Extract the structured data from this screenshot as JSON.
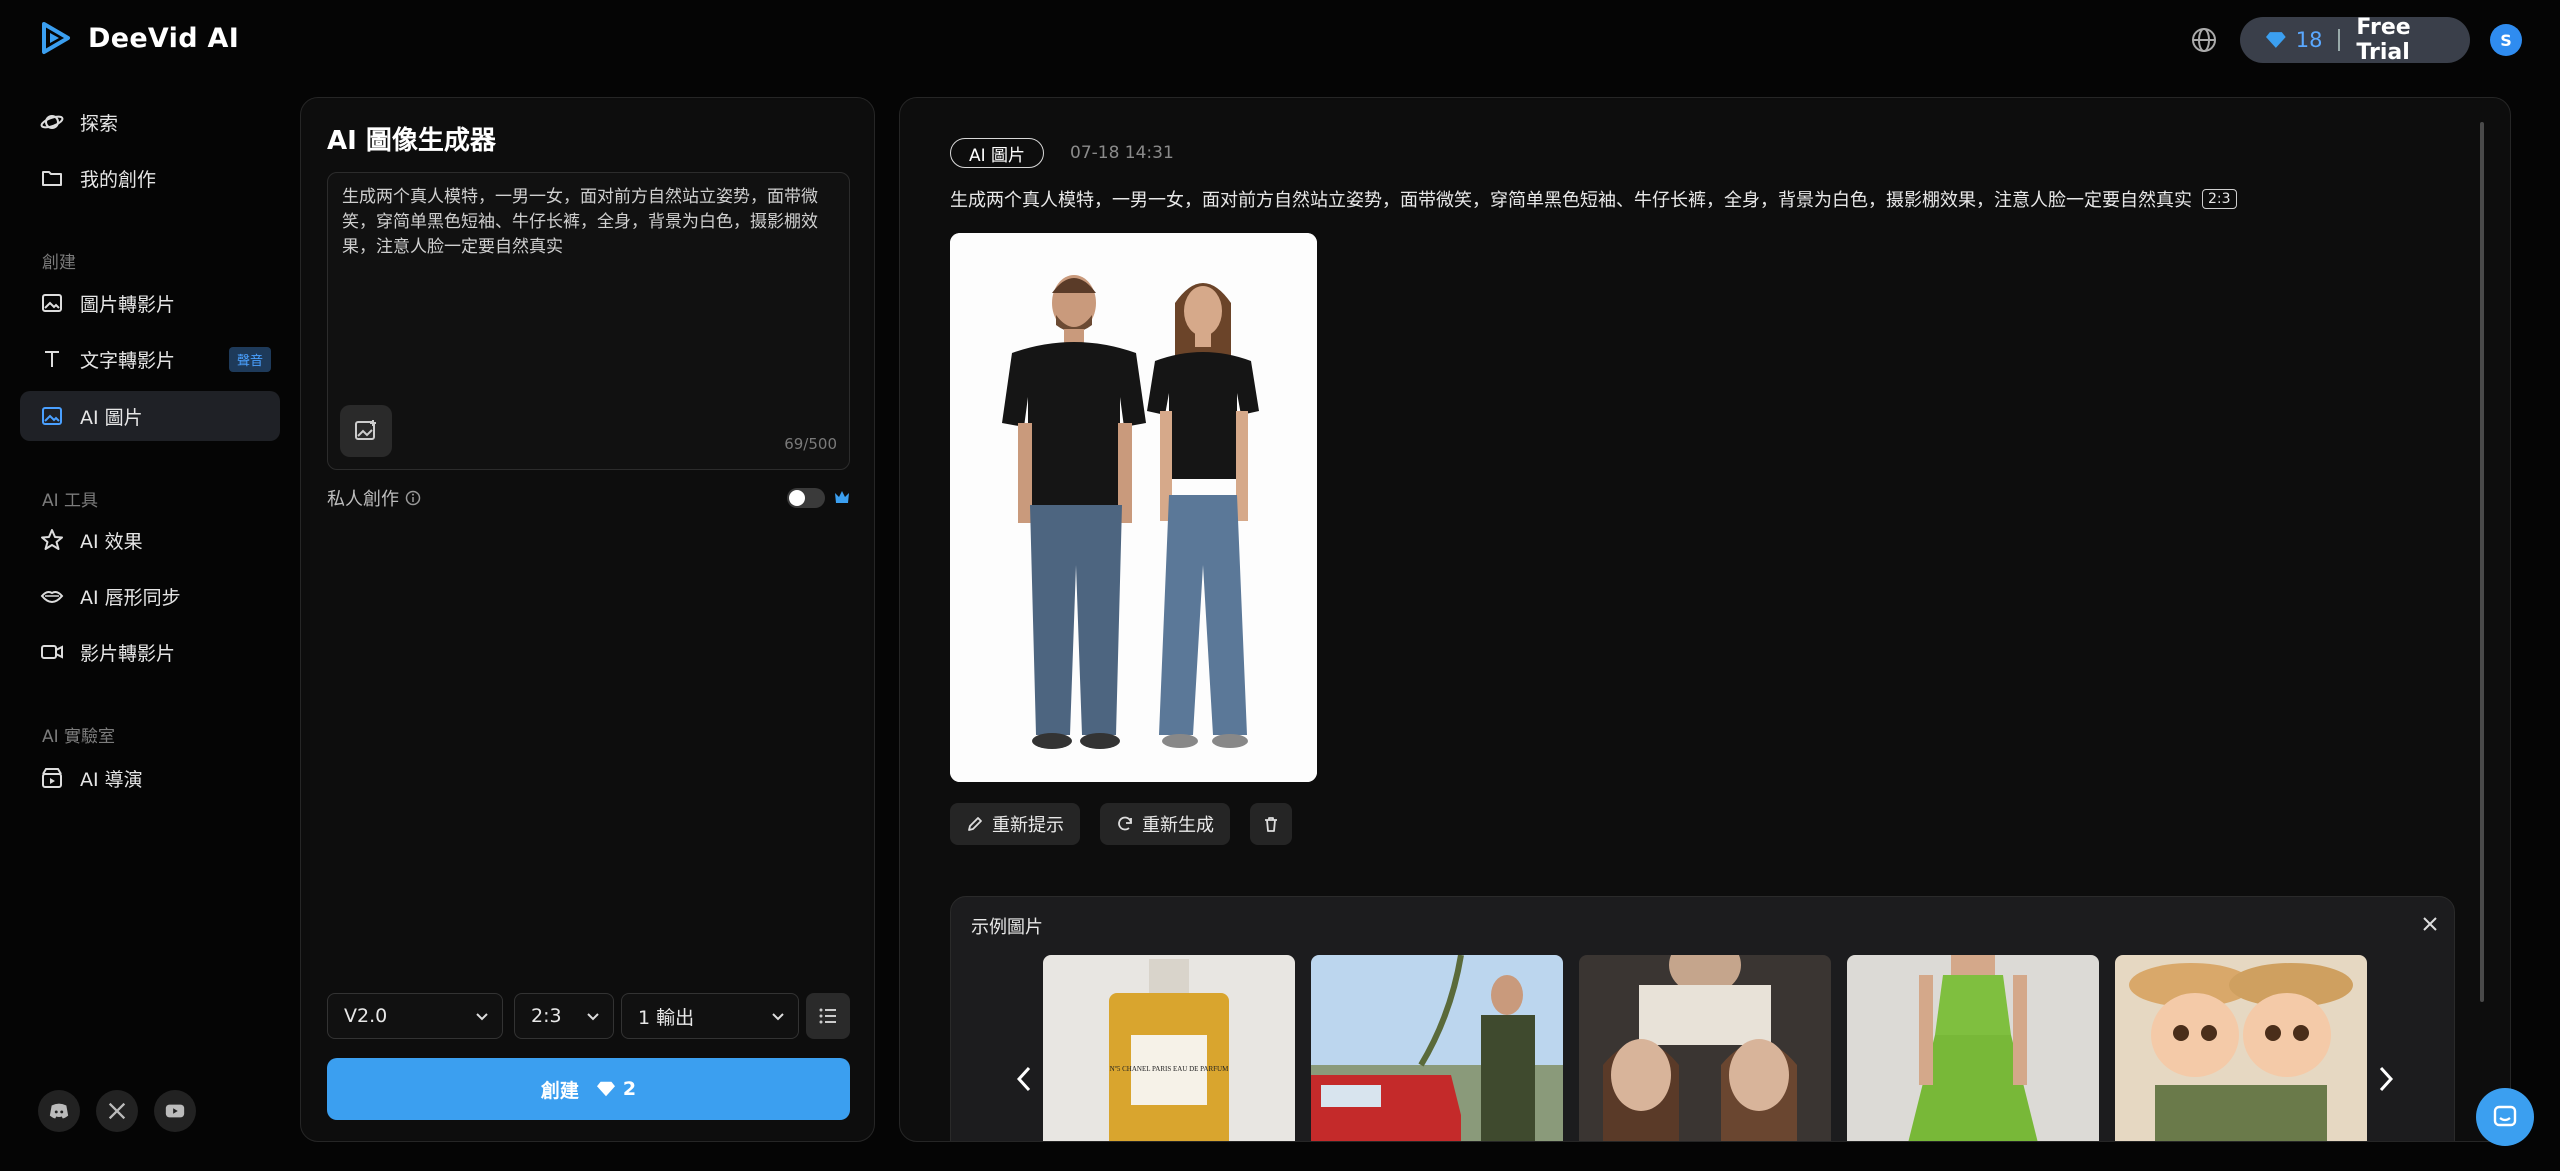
{
  "app": {
    "name": "DeeVid AI"
  },
  "header": {
    "credits": "18",
    "plan_label": "Free Trial",
    "avatar_initial": "S"
  },
  "sidebar": {
    "explore": "探索",
    "my_creations": "我的創作",
    "section_create": "創建",
    "image_to_video": "圖片轉影片",
    "text_to_video": "文字轉影片",
    "text_to_video_badge": "聲音",
    "ai_image": "AI 圖片",
    "section_tools": "AI 工具",
    "ai_effects": "AI 效果",
    "ai_lipsync": "AI 唇形同步",
    "video_to_video": "影片轉影片",
    "section_lab": "AI 實驗室",
    "ai_director": "AI 導演"
  },
  "generator": {
    "title": "AI 圖像生成器",
    "prompt": "生成两个真人模特，一男一女，面对前方自然站立姿势，面带微笑，穿简单黑色短袖、牛仔长裤，全身，背景为白色，摄影棚效果，注意人脸一定要自然真实",
    "char_count": "69/500",
    "private_label": "私人創作",
    "model": "V2.0",
    "ratio": "2:3",
    "outputs": "1 輸出",
    "create_label": "創建",
    "create_cost": "2"
  },
  "result": {
    "tag": "AI 圖片",
    "timestamp": "07-18 14:31",
    "prompt": "生成两个真人模特，一男一女，面对前方自然站立姿势，面带微笑，穿简单黑色短袖、牛仔长裤，全身，背景为白色，摄影棚效果，注意人脸一定要自然真实",
    "ratio": "2:3",
    "reprompt_label": "重新提示",
    "regenerate_label": "重新生成"
  },
  "examples": {
    "title": "示例圖片",
    "perfume_text": "Nº5 CHANEL PARIS EAU DE PARFUM"
  },
  "colors": {
    "accent": "#3b9ff0",
    "background": "#050505",
    "panel": "#0d0d0d"
  }
}
